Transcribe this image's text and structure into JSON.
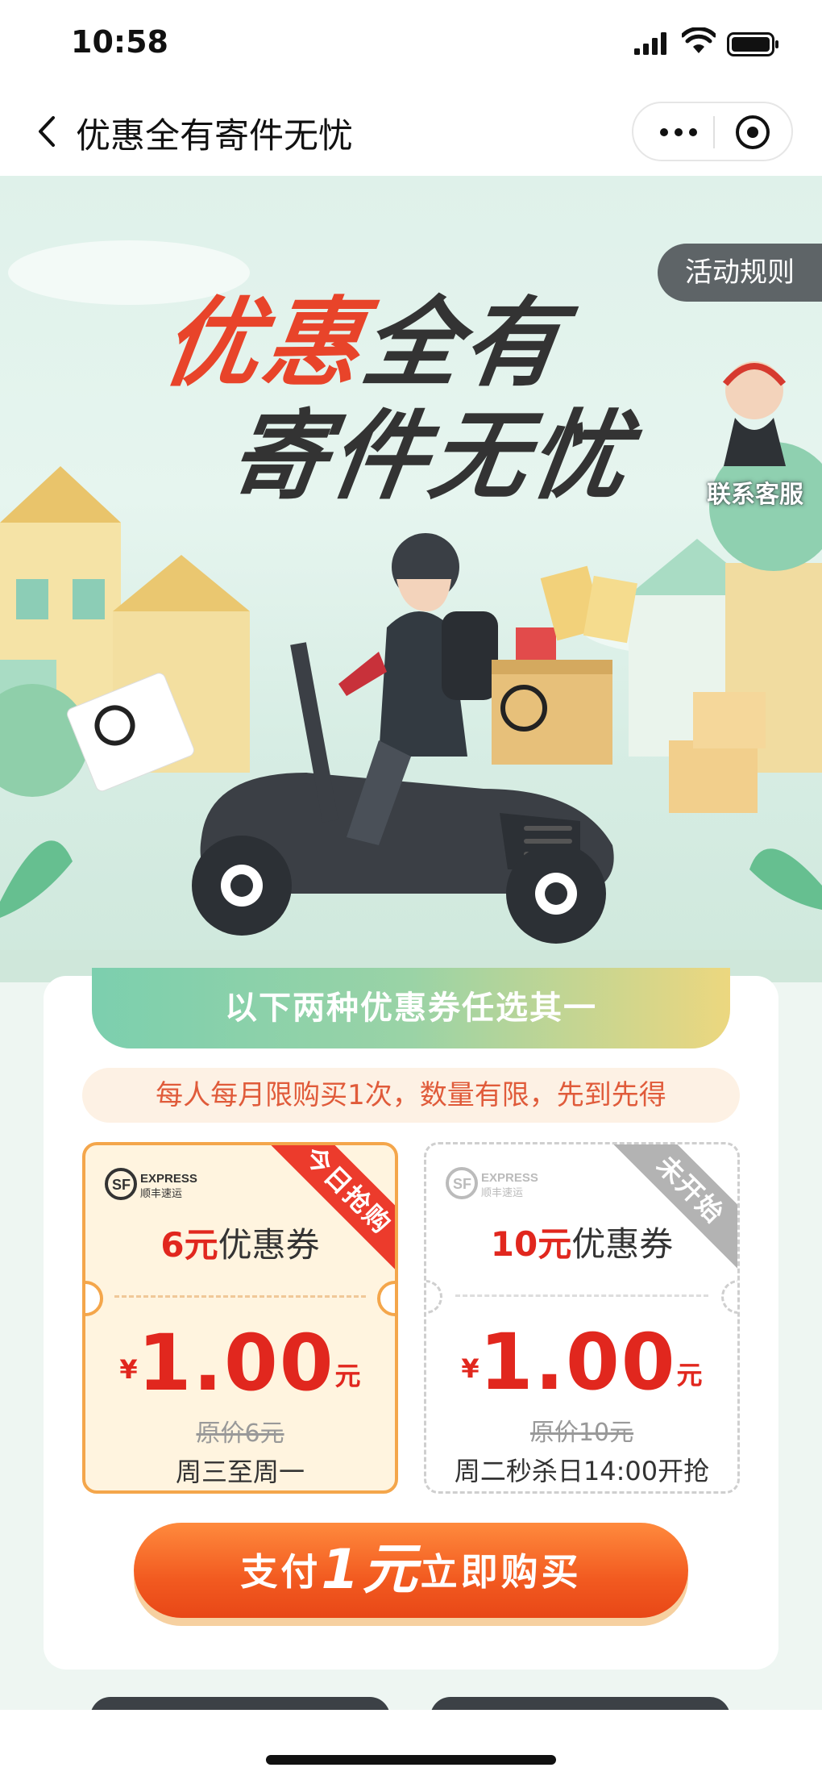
{
  "status_bar": {
    "time": "10:58"
  },
  "nav": {
    "title": "优惠全有寄件无忧"
  },
  "hero": {
    "rules_button": "活动规则",
    "headline_line1_red": "优惠",
    "headline_line1_rest": "全有",
    "headline_line2": "寄件无忧",
    "customer_service": "联系客服"
  },
  "offer": {
    "banner": "以下两种优惠券任选其一",
    "note": "每人每月限购买1次，数量有限，先到先得",
    "coupons": [
      {
        "ribbon": "今日抢购",
        "value": "6元",
        "suffix": "优惠券",
        "currency": "¥",
        "price": "1.00",
        "unit": "元",
        "original": "原价6元",
        "availability": "周三至周一",
        "state": "active"
      },
      {
        "ribbon": "未开始",
        "value": "10元",
        "suffix": "优惠券",
        "currency": "¥",
        "price": "1.00",
        "unit": "元",
        "original": "原价10元",
        "availability": "周二秒杀日14:00开抢",
        "state": "inactive"
      }
    ],
    "buy_button": {
      "pre": "支付",
      "amount": "1元",
      "post": "立即购买"
    }
  },
  "colors": {
    "accent_red": "#e1271e",
    "button_orange": "#f25a20",
    "banner_green": "#7ccfae"
  }
}
